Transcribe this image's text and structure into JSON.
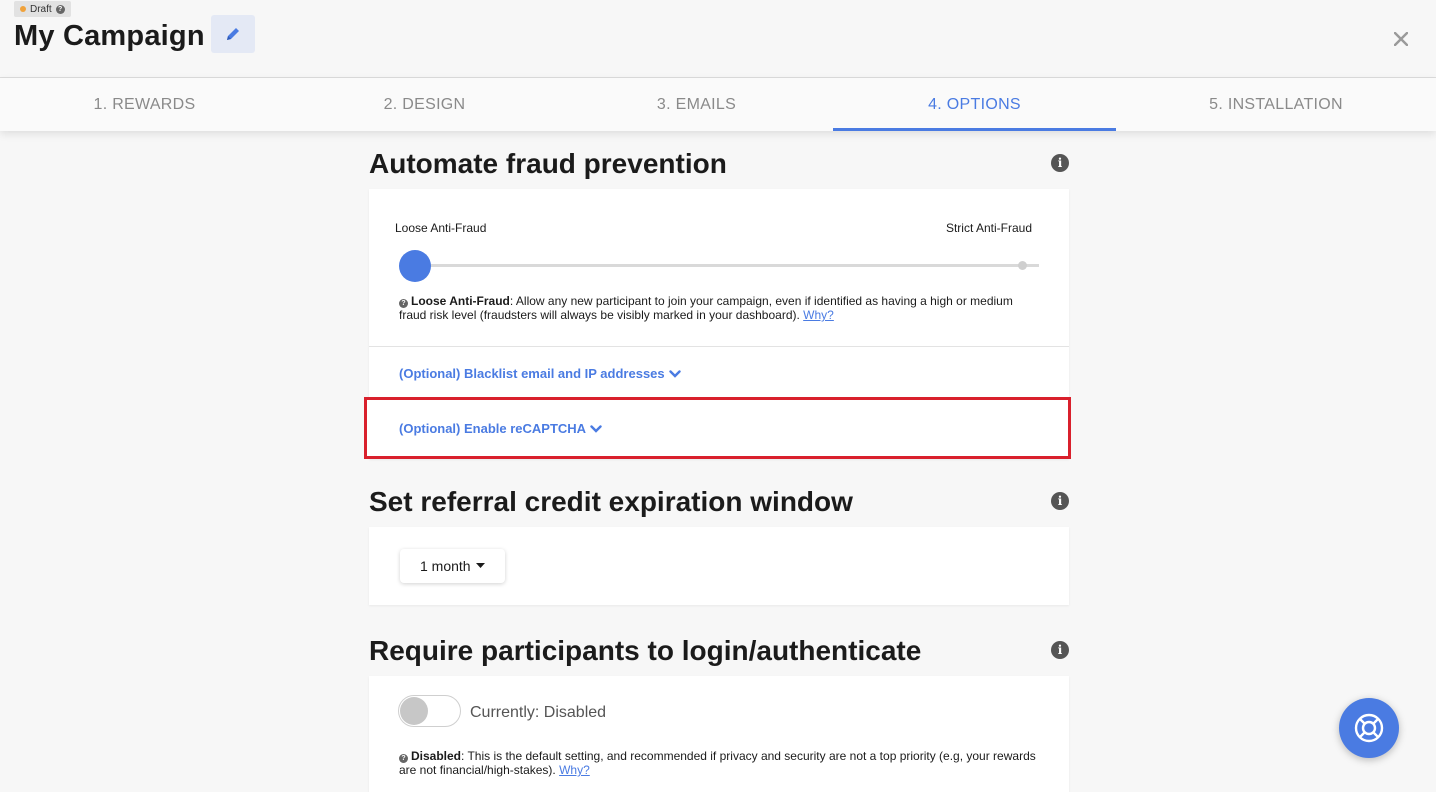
{
  "header": {
    "status_badge": "Draft",
    "title": "My Campaign",
    "edit_icon": "pencil-icon",
    "close_icon": "close-icon"
  },
  "tabs": [
    {
      "label": "1. REWARDS",
      "active": false
    },
    {
      "label": "2. DESIGN",
      "active": false
    },
    {
      "label": "3. EMAILS",
      "active": false
    },
    {
      "label": "4. OPTIONS",
      "active": true
    },
    {
      "label": "5. INSTALLATION",
      "active": false
    }
  ],
  "fraud": {
    "title": "Automate fraud prevention",
    "slider_left_label": "Loose Anti-Fraud",
    "slider_right_label": "Strict Anti-Fraud",
    "slider_level": 0,
    "description_bold": "Loose Anti-Fraud",
    "description_line1": ": Allow any new participant to join your campaign, even if identified as having a high or medium",
    "description_line2": "fraud risk level (fraudsters will always be visibly marked in your dashboard).",
    "why_link": "Why?",
    "blacklist_link": "(Optional) Blacklist email and IP addresses",
    "recaptcha_link": "(Optional) Enable reCAPTCHA"
  },
  "expiration": {
    "title": "Set referral credit expiration window",
    "dropdown_value": "1 month"
  },
  "auth": {
    "title": "Require participants to login/authenticate",
    "toggle_state": "off",
    "toggle_label": "Currently: Disabled",
    "description_bold": "Disabled",
    "description_line1": ": This is the default setting, and recommended if privacy and security are not a top priority (e.g, your rewards",
    "description_line2": "are not financial/high-stakes).",
    "why_link": "Why?"
  },
  "colors": {
    "accent": "#4a7be2",
    "highlight": "#d9202c",
    "draft_dot": "#f0a23b"
  },
  "help_button_icon": "lifebuoy-icon"
}
